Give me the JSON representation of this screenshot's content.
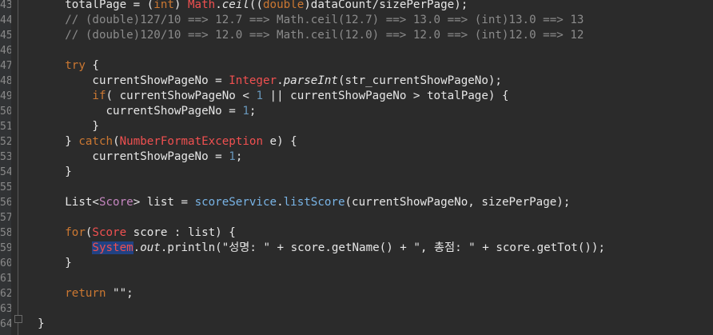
{
  "editor": {
    "language": "java",
    "lines": [
      {
        "no": "43",
        "tokens": [
          [
            "      ",
            "t-plain"
          ],
          [
            "totalPage = (",
            "t-plain"
          ],
          [
            "int",
            "t-kw"
          ],
          [
            ") ",
            "t-plain"
          ],
          [
            "Math",
            "t-cls"
          ],
          [
            ".",
            "t-plain"
          ],
          [
            "ceil",
            "t-italic"
          ],
          [
            "((",
            "t-plain"
          ],
          [
            "double",
            "t-kw"
          ],
          [
            ")dataCount/sizePerPage);",
            "t-plain"
          ]
        ]
      },
      {
        "no": "44",
        "tokens": [
          [
            "      ",
            "t-plain"
          ],
          [
            "// (double)127/10 ==> 12.7 ==> Math.ceil(12.7) ==> 13.0 ==> (int)13.0 ==> 13",
            "t-cmt"
          ]
        ]
      },
      {
        "no": "45",
        "tokens": [
          [
            "      ",
            "t-plain"
          ],
          [
            "// (double)120/10 ==> 12.0 ==> Math.ceil(12.0) ==> 12.0 ==> (int)12.0 ==> 12",
            "t-cmt"
          ]
        ]
      },
      {
        "no": "46",
        "tokens": []
      },
      {
        "no": "47",
        "tokens": [
          [
            "      ",
            "t-plain"
          ],
          [
            "try",
            "t-kw"
          ],
          [
            " {",
            "t-plain"
          ]
        ]
      },
      {
        "no": "48",
        "tokens": [
          [
            "          ",
            "t-plain"
          ],
          [
            "currentShowPageNo = ",
            "t-plain"
          ],
          [
            "Integer",
            "t-cls"
          ],
          [
            ".",
            "t-plain"
          ],
          [
            "parseInt",
            "t-italic"
          ],
          [
            "(str_currentShowPageNo);",
            "t-plain"
          ]
        ]
      },
      {
        "no": "49",
        "tokens": [
          [
            "          ",
            "t-plain"
          ],
          [
            "if",
            "t-kw"
          ],
          [
            "( currentShowPageNo < ",
            "t-plain"
          ],
          [
            "1",
            "t-num"
          ],
          [
            " || currentShowPageNo > totalPage) {",
            "t-plain"
          ]
        ]
      },
      {
        "no": "50",
        "tokens": [
          [
            "            ",
            "t-plain"
          ],
          [
            "currentShowPageNo = ",
            "t-plain"
          ],
          [
            "1",
            "t-num"
          ],
          [
            ";",
            "t-plain"
          ]
        ]
      },
      {
        "no": "51",
        "tokens": [
          [
            "          ",
            "t-plain"
          ],
          [
            "}",
            "t-plain"
          ]
        ]
      },
      {
        "no": "52",
        "tokens": [
          [
            "      ",
            "t-plain"
          ],
          [
            "} ",
            "t-plain"
          ],
          [
            "catch",
            "t-kw"
          ],
          [
            "(",
            "t-plain"
          ],
          [
            "NumberFormatException",
            "t-cls"
          ],
          [
            " e) {",
            "t-plain"
          ]
        ]
      },
      {
        "no": "53",
        "tokens": [
          [
            "          ",
            "t-plain"
          ],
          [
            "currentShowPageNo = ",
            "t-plain"
          ],
          [
            "1",
            "t-num"
          ],
          [
            ";",
            "t-plain"
          ]
        ]
      },
      {
        "no": "54",
        "tokens": [
          [
            "      ",
            "t-plain"
          ],
          [
            "}",
            "t-plain"
          ]
        ]
      },
      {
        "no": "55",
        "tokens": []
      },
      {
        "no": "56",
        "tokens": [
          [
            "      ",
            "t-plain"
          ],
          [
            "List<",
            "t-plain"
          ],
          [
            "Score",
            "t-gen"
          ],
          [
            "> list = ",
            "t-plain"
          ],
          [
            "scoreService",
            "t-call"
          ],
          [
            ".",
            "t-plain"
          ],
          [
            "listScore",
            "t-call"
          ],
          [
            "(currentShowPageNo, sizePerPage);",
            "t-plain"
          ]
        ]
      },
      {
        "no": "57",
        "tokens": []
      },
      {
        "no": "58",
        "tokens": [
          [
            "      ",
            "t-plain"
          ],
          [
            "for",
            "t-kw"
          ],
          [
            "(",
            "t-plain"
          ],
          [
            "Score",
            "t-cls"
          ],
          [
            " score : list) {",
            "t-plain"
          ]
        ]
      },
      {
        "no": "59",
        "tokens": [
          [
            "          ",
            "t-plain"
          ],
          [
            "System",
            "t-sel"
          ],
          [
            ".",
            "t-plain"
          ],
          [
            "out",
            "t-italic"
          ],
          [
            ".println(\"성명: \" + score.getName() + \", 총점: \" + score.getTot());",
            "t-plain"
          ]
        ]
      },
      {
        "no": "60",
        "tokens": [
          [
            "      ",
            "t-plain"
          ],
          [
            "}",
            "t-plain"
          ]
        ]
      },
      {
        "no": "61",
        "tokens": []
      },
      {
        "no": "62",
        "tokens": [
          [
            "      ",
            "t-plain"
          ],
          [
            "return",
            "t-kw"
          ],
          [
            " \"\";",
            "t-plain"
          ]
        ]
      },
      {
        "no": "63",
        "tokens": []
      },
      {
        "no": "64",
        "tokens": [
          [
            "  ",
            "t-plain"
          ],
          [
            "}",
            "t-plain"
          ]
        ]
      }
    ]
  },
  "colors": {
    "background": "#2b2b2b",
    "keyword": "#cc7832",
    "class": "#f05050",
    "comment": "#8b8b8b",
    "number": "#6897bb",
    "selection": "#214283"
  }
}
